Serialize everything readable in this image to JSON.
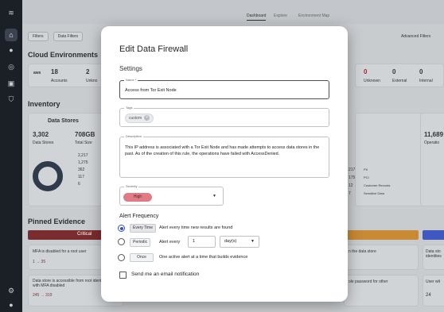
{
  "topnav": {
    "dashboard": "Dashboard",
    "explore": "Explore",
    "env_map": "Environment Map"
  },
  "filters": {
    "filters": "Filters",
    "data_filters": "Data Filters",
    "advanced": "Advanced Filters"
  },
  "cloud": {
    "title": "Cloud Environments",
    "aws_count": "18",
    "aws_label": "Accounts",
    "unknown_left": "2",
    "unknown_left_label": "Unkno",
    "right_unknown": "0",
    "right_unknown_label": "Unknown",
    "external": "0",
    "external_label": "External",
    "internal": "0",
    "internal_label": "Internal"
  },
  "inventory": {
    "title": "Inventory",
    "data_stores_title": "Data Stores",
    "ds_count": "3,302",
    "ds_count_label": "Data Stores",
    "total_size": "708GB",
    "total_size_label": "Total Size",
    "tabs": [
      "Service",
      "Size",
      "Origin",
      "Public"
    ],
    "legend": [
      "2,217",
      "1,275",
      "362",
      "117",
      "6"
    ],
    "right_nums": [
      {
        "value": "217",
        "label": "PII"
      },
      {
        "value": "175",
        "label": "PCI"
      },
      {
        "value": "12",
        "label": "Customer Records"
      },
      {
        "value": "7",
        "label": "Sensitive Data"
      }
    ],
    "far_right_value": "11,689",
    "far_right_label": "Operatio"
  },
  "pinned": {
    "title": "Pinned Evidence",
    "critical": "Critical",
    "item1": "MFA is disabled for a root user",
    "item1_counts": "1 → 35",
    "item2": "Data store is accessible from root identities with MFA disabled",
    "item2_counts": "245 → 319",
    "mid_item1": "n the data store",
    "mid_item2": "ole password for other",
    "right_item1": "Data sto identities",
    "right_item2": "User wit",
    "right_count": "24"
  },
  "modal": {
    "title": "Edit Data Firewall",
    "section": "Settings",
    "name_label": "Name *",
    "name_value": "Access from Tor Exit Node",
    "tags_label": "Tags",
    "tag": "custom",
    "description_label": "Description",
    "description": "This IP address is associated with a Tor Exit Node and has made attempts to access data stores in the past. As of the creation of this rule, the operations have failed with AccessDenied.",
    "severity_label": "Severity",
    "severity": "High",
    "frequency_title": "Alert Frequency",
    "opt1_tag": "Every Time",
    "opt1_text": "Alert every time new results are found",
    "opt2_tag": "Periodic",
    "opt2_text": "Alert every",
    "opt2_num": "1",
    "opt2_unit": "day(s)",
    "opt3_tag": "Once",
    "opt3_text": "One active alert at a time that builds evidence",
    "email_label": "Send me an email notification"
  },
  "colors": {
    "accent": "#2f55c9",
    "severity_high": "#e07b86",
    "critical_bar": "#7a2d30"
  }
}
